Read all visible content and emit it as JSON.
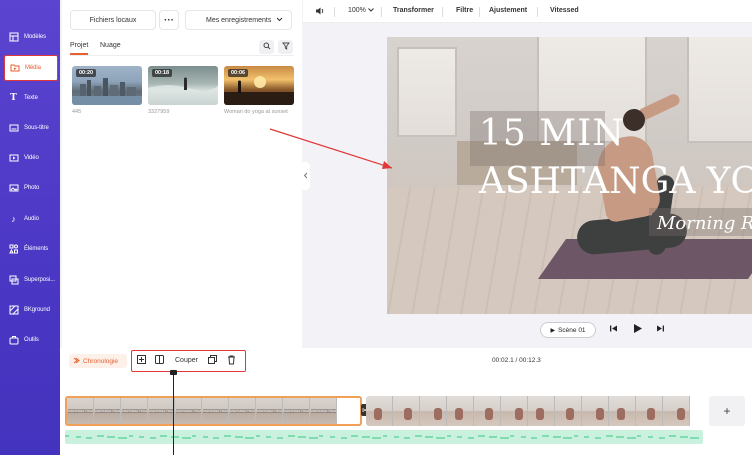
{
  "sidebar": {
    "items": [
      {
        "label": "Modèles",
        "icon": "template-icon"
      },
      {
        "label": "Média",
        "icon": "media-folder-icon"
      },
      {
        "label": "Texte",
        "icon": "text-icon"
      },
      {
        "label": "Sous-titre",
        "icon": "subtitle-icon"
      },
      {
        "label": "Vidéo",
        "icon": "video-icon"
      },
      {
        "label": "Photo",
        "icon": "photo-icon"
      },
      {
        "label": "Audio",
        "icon": "audio-icon"
      },
      {
        "label": "Éléments",
        "icon": "elements-icon"
      },
      {
        "label": "Superposi...",
        "icon": "overlay-icon"
      },
      {
        "label": "BKground",
        "icon": "background-icon"
      },
      {
        "label": "Outils",
        "icon": "tools-icon"
      }
    ],
    "active_index": 1,
    "accent_color": "#e6612f"
  },
  "media_panel": {
    "local_files_button": "Fichiers locaux",
    "more_button": "···",
    "saves_button": "Mes enregistrements",
    "tabs": [
      "Projet",
      "Nuage"
    ],
    "thumbnails": [
      {
        "duration": "00:20",
        "caption": "445"
      },
      {
        "duration": "00:18",
        "caption": "3327959"
      },
      {
        "duration": "00:06",
        "caption": "Woman do yoga at sunset"
      }
    ]
  },
  "toolbar": {
    "zoom": "100%",
    "transform": "Transformer",
    "filter": "Filtre",
    "adjust": "Ajustement",
    "speed": "Vitessed"
  },
  "preview": {
    "title_line1": "15 MIN",
    "title_line2": "ASHTANGA YOG",
    "subtitle": "Morning Ro"
  },
  "playback": {
    "scene_label": "Scène 01"
  },
  "timeline": {
    "chrono_label": "Chronologie",
    "cut_label": "Couper",
    "time": "00:02.1 / 00:12.3",
    "clip_thumb_text": "ASHTANGA YOGA"
  }
}
